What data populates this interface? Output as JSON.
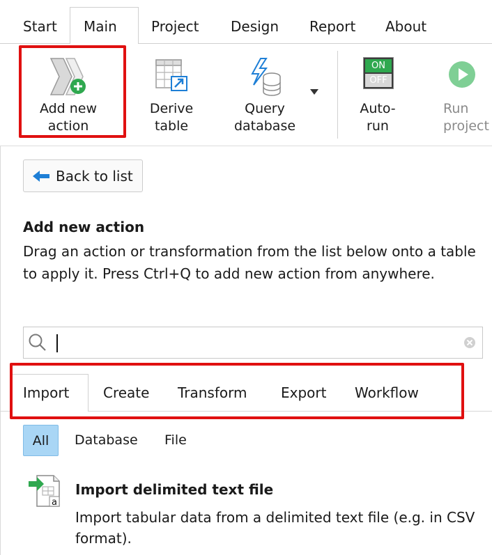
{
  "ribbon": {
    "tabs": [
      {
        "label": "Start"
      },
      {
        "label": "Main"
      },
      {
        "label": "Project"
      },
      {
        "label": "Design"
      },
      {
        "label": "Report"
      },
      {
        "label": "About"
      }
    ],
    "active_tab": "Main"
  },
  "toolbar": {
    "add_action": "Add new\naction",
    "derive_table": "Derive\ntable",
    "query_database": "Query\ndatabase",
    "auto_run": "Auto-\nrun",
    "auto_run_on": "ON",
    "auto_run_off": "OFF",
    "run_project": "Run\nproject"
  },
  "panel": {
    "back_label": "Back to list",
    "title": "Add new action",
    "description": "Drag an action or transformation from the list below onto a table to apply it. Press Ctrl+Q to add new action from anywhere.",
    "search_value": "",
    "search_placeholder": ""
  },
  "categories": {
    "tabs": [
      {
        "label": "Import"
      },
      {
        "label": "Create"
      },
      {
        "label": "Transform"
      },
      {
        "label": "Export"
      },
      {
        "label": "Workflow"
      }
    ],
    "active_tab": "Import"
  },
  "filters": {
    "items": [
      {
        "label": "All"
      },
      {
        "label": "Database"
      },
      {
        "label": "File"
      }
    ],
    "active": "All"
  },
  "actions": [
    {
      "title": "Import delimited text file",
      "description": "Import tabular data from a delimited text file (e.g. in CSV format)."
    }
  ],
  "colors": {
    "highlight": "#e01010",
    "filter_active": "#a9d6f5",
    "back_arrow": "#1e7fd6",
    "auto_run_on": "#2fa84f",
    "run_disabled": "#7fcf95"
  }
}
